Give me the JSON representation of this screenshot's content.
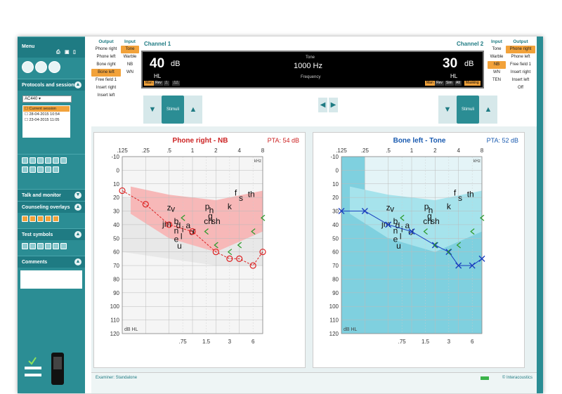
{
  "sidebar": {
    "menu": "Menu",
    "protocols": "Protocols and sessions",
    "protocol_value": "AC440",
    "sessions": [
      "Current session",
      "28-04-2015 10:54",
      "23-04-2015 11:05"
    ],
    "talk": "Talk and monitor",
    "counseling": "Counseling overlays",
    "test_symbols": "Test symbols",
    "comments": "Comments"
  },
  "ch1": {
    "label": "Channel 1",
    "output_header": "Output",
    "input_header": "Input",
    "outputs": [
      "Phone right",
      "Phone left",
      "Bone right",
      "Bone left",
      "Free field 1",
      "Insert right",
      "Insert left"
    ],
    "inputs": [
      "Tone",
      "Warble",
      "NB",
      "WN"
    ],
    "selected_input": "Tone",
    "selected_output": "Bone left"
  },
  "ch2": {
    "label": "Channel 2",
    "input_header": "Input",
    "output_header": "Output",
    "inputs": [
      "Tone",
      "Warble",
      "NB",
      "WN",
      "TEN"
    ],
    "outputs": [
      "Phone right",
      "Phone left",
      "Free field 1",
      "Insert right",
      "Insert left",
      "Off"
    ],
    "selected_input": "NB",
    "selected_output": "Phone right"
  },
  "display": {
    "left_level": "40",
    "left_unit": "dB",
    "left_sub": "HL",
    "center_top": "Tone",
    "freq": "1000 Hz",
    "freq_label": "Frequency",
    "right_level": "30",
    "right_unit": "dB",
    "right_sub": "HL",
    "left_btns": [
      "Man",
      "Rev",
      "⎍",
      "⎍⎍"
    ],
    "right_btns": [
      "Man",
      "Rev",
      "Sim",
      "Alt",
      "Masking"
    ]
  },
  "stimuli": "Stimuli",
  "left_chart": {
    "title": "Phone right - NB",
    "pta": "PTA:   54 dB",
    "unit": "dB HL",
    "khz": "kHz"
  },
  "right_chart": {
    "title": "Bone left - Tone",
    "pta": "PTA:   52 dB",
    "unit": "dB HL",
    "khz": "kHz"
  },
  "axes": {
    "top": [
      ".125",
      ".25",
      ".5",
      "1",
      "2",
      "4",
      "8"
    ],
    "bottom": [
      ".75",
      "1.5",
      "3",
      "6"
    ],
    "y": [
      "-10",
      "0",
      "10",
      "20",
      "30",
      "40",
      "50",
      "60",
      "70",
      "80",
      "90",
      "100",
      "110",
      "120"
    ]
  },
  "speech": [
    "z",
    "v",
    "p",
    "h",
    "g",
    "f",
    "s",
    "th",
    "j",
    "m",
    "b",
    "d",
    "n",
    "k",
    "ch",
    "sh",
    "a",
    "o",
    "r",
    "i",
    "e",
    "l",
    "u"
  ],
  "status": {
    "examiner": "Examiner: Standalone",
    "brand": "© Interacoustics"
  },
  "chart_data": [
    {
      "type": "line",
      "title": "Phone right - NB",
      "x": [
        ".125",
        ".25",
        ".5",
        "1",
        "2",
        "3",
        "4",
        "6",
        "8"
      ],
      "series": [
        {
          "values": [
            15,
            25,
            40,
            45,
            60,
            65,
            65,
            70,
            60
          ]
        }
      ],
      "ylim": [
        -10,
        120
      ]
    },
    {
      "type": "line",
      "title": "Bone left - Tone",
      "x": [
        ".125",
        ".25",
        ".5",
        "1",
        "2",
        "3",
        "4",
        "6",
        "8"
      ],
      "series": [
        {
          "values": [
            30,
            30,
            40,
            45,
            55,
            60,
            70,
            70,
            65
          ]
        }
      ],
      "ylim": [
        -10,
        120
      ]
    }
  ]
}
